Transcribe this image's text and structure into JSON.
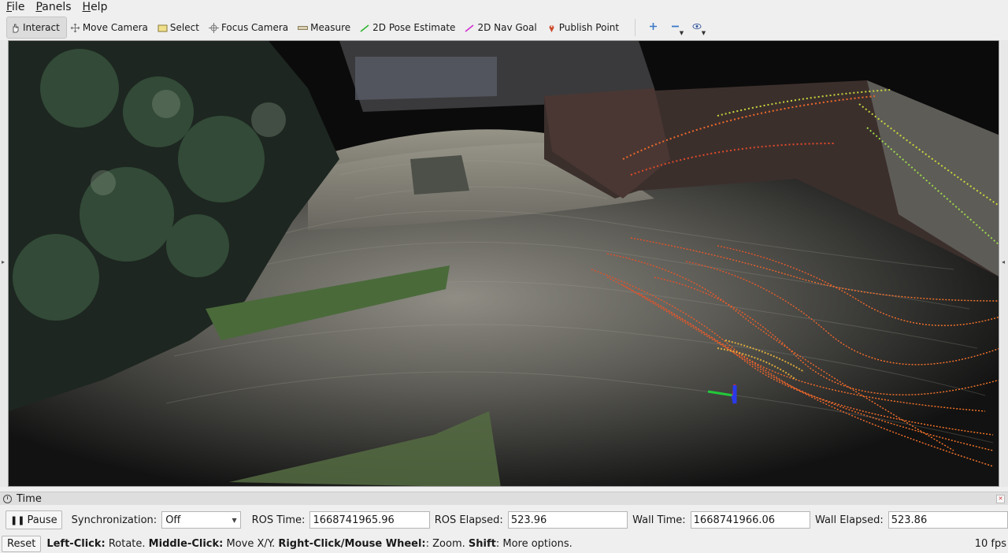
{
  "menu": {
    "items": [
      {
        "u": "F",
        "rest": "ile"
      },
      {
        "u": "P",
        "rest": "anels"
      },
      {
        "u": "H",
        "rest": "elp"
      }
    ]
  },
  "toolbar": {
    "tools": [
      {
        "label": "Interact",
        "icon": "hand-cursor-icon",
        "color": "#555555",
        "active": true
      },
      {
        "label": "Move Camera",
        "icon": "move-arrows-icon",
        "color": "#777777",
        "active": false
      },
      {
        "label": "Select",
        "icon": "select-rect-icon",
        "color": "#f0e08a",
        "active": false
      },
      {
        "label": "Focus Camera",
        "icon": "focus-crosshair-icon",
        "color": "#777777",
        "active": false
      },
      {
        "label": "Measure",
        "icon": "ruler-icon",
        "color": "#b8a88a",
        "active": false
      },
      {
        "label": "2D Pose Estimate",
        "icon": "pose-arrow-icon",
        "color": "#2fb52f",
        "active": false
      },
      {
        "label": "2D Nav Goal",
        "icon": "nav-goal-arrow-icon",
        "color": "#d02fd0",
        "active": false
      },
      {
        "label": "Publish Point",
        "icon": "map-pin-icon",
        "color": "#cc4a2a",
        "active": false
      }
    ]
  },
  "time_panel": {
    "title": "Time",
    "pause_label": "Pause",
    "sync_label": "Synchronization:",
    "sync_value": "Off",
    "ros_time_label": "ROS Time:",
    "ros_time": "1668741965.96",
    "ros_elapsed_label": "ROS Elapsed:",
    "ros_elapsed": "523.96",
    "wall_time_label": "Wall Time:",
    "wall_time": "1668741966.06",
    "wall_elapsed_label": "Wall Elapsed:",
    "wall_elapsed": "523.86"
  },
  "status": {
    "reset_label": "Reset",
    "left_click": "Left-Click:",
    "left_click_desc": " Rotate. ",
    "middle_click": "Middle-Click:",
    "middle_click_desc": " Move X/Y. ",
    "right_click": "Right-Click/Mouse Wheel:",
    "right_click_desc": ": Zoom. ",
    "shift": "Shift",
    "shift_desc": ": More options.",
    "fps": "10 fps"
  }
}
